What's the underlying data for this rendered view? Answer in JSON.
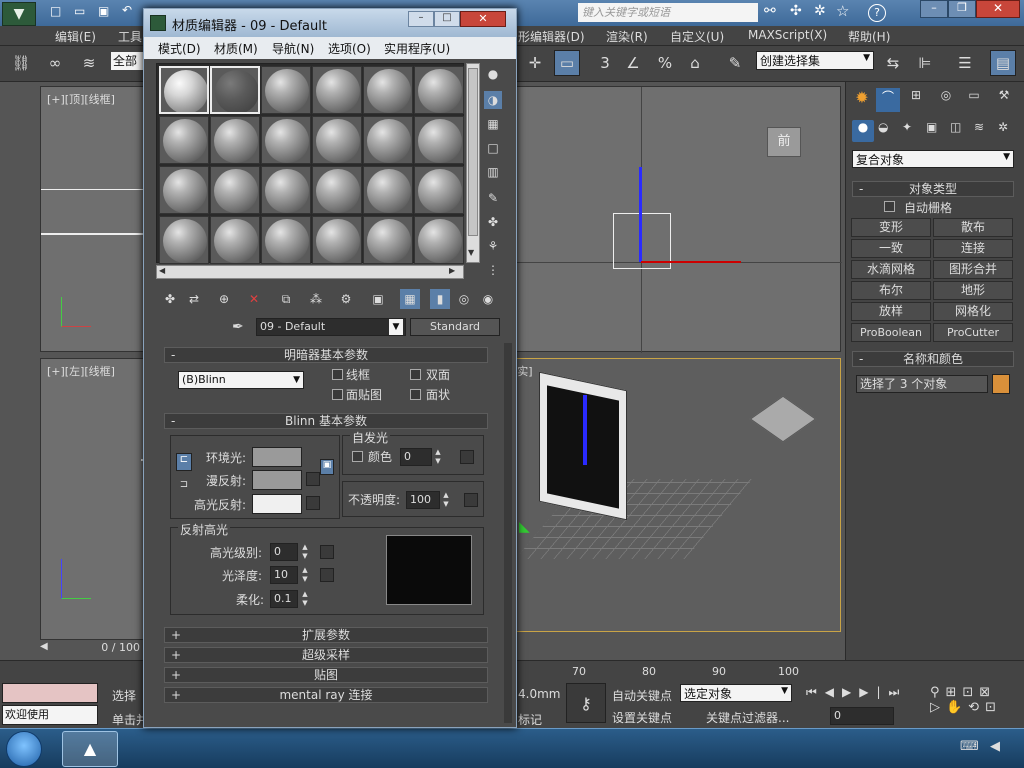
{
  "app": {
    "search_placeholder": "键入关键字或短语",
    "menu": [
      "编辑(E)",
      "工具",
      "形编辑器(D)",
      "渲染(R)",
      "自定义(U)",
      "MAXScript(X)",
      "帮助(H)"
    ],
    "selection_filter": "全部",
    "named_selection": "创建选择集"
  },
  "viewports": {
    "top_label": "[+][顶][线框]",
    "left_label": "[+][左][线框]",
    "persp_label": "[实]",
    "front_cube_label": "前"
  },
  "material_editor": {
    "title": "材质编辑器 - 09 - Default",
    "menu": [
      "模式(D)",
      "材质(M)",
      "导航(N)",
      "选项(O)",
      "实用程序(U)"
    ],
    "material_name": "09 - Default",
    "material_type": "Standard",
    "shader_rollout": {
      "title": "明暗器基本参数",
      "shader": "(B)Blinn",
      "wire": "线框",
      "two_sided": "双面",
      "face_map": "面贴图",
      "faceted": "面状"
    },
    "blinn_rollout": {
      "title": "Blinn 基本参数",
      "ambient": "环境光:",
      "diffuse": "漫反射:",
      "specular": "高光反射:",
      "self_illum": "自发光",
      "color_label": "颜色",
      "self_illum_value": "0",
      "opacity_label": "不透明度:",
      "opacity_value": "100",
      "spec_group": "反射高光",
      "spec_level_label": "高光级别:",
      "spec_level": "0",
      "gloss_label": "光泽度:",
      "gloss": "10",
      "soften_label": "柔化:",
      "soften": "0.1"
    },
    "collapsed_rollouts": [
      "扩展参数",
      "超级采样",
      "贴图",
      "mental ray 连接"
    ]
  },
  "command_panel": {
    "dropdown": "复合对象",
    "object_type_title": "对象类型",
    "autogrid": "自动栅格",
    "buttons": [
      "变形",
      "散布",
      "一致",
      "连接",
      "水滴网格",
      "图形合并",
      "布尔",
      "地形",
      "放样",
      "网格化",
      "ProBoolean",
      "ProCutter"
    ],
    "name_color_title": "名称和颜色",
    "name_value": "选择了 3 个对象",
    "object_color": "#d9903a"
  },
  "bottom": {
    "timeline_pos": "0 / 100",
    "ruler": [
      "70",
      "80",
      "90",
      "100"
    ],
    "status_welcome": "欢迎使用 MAXScri",
    "status_select": "选择",
    "status_click": "单击并",
    "coord": "4.0mm",
    "auto_key": "自动关键点",
    "set_key": "设置关键点",
    "key_mode": "选定对象",
    "key_filter": "关键点过滤器...",
    "add_tag": "添加时间标记",
    "frame": "0",
    "tag_suffix": "标记"
  }
}
